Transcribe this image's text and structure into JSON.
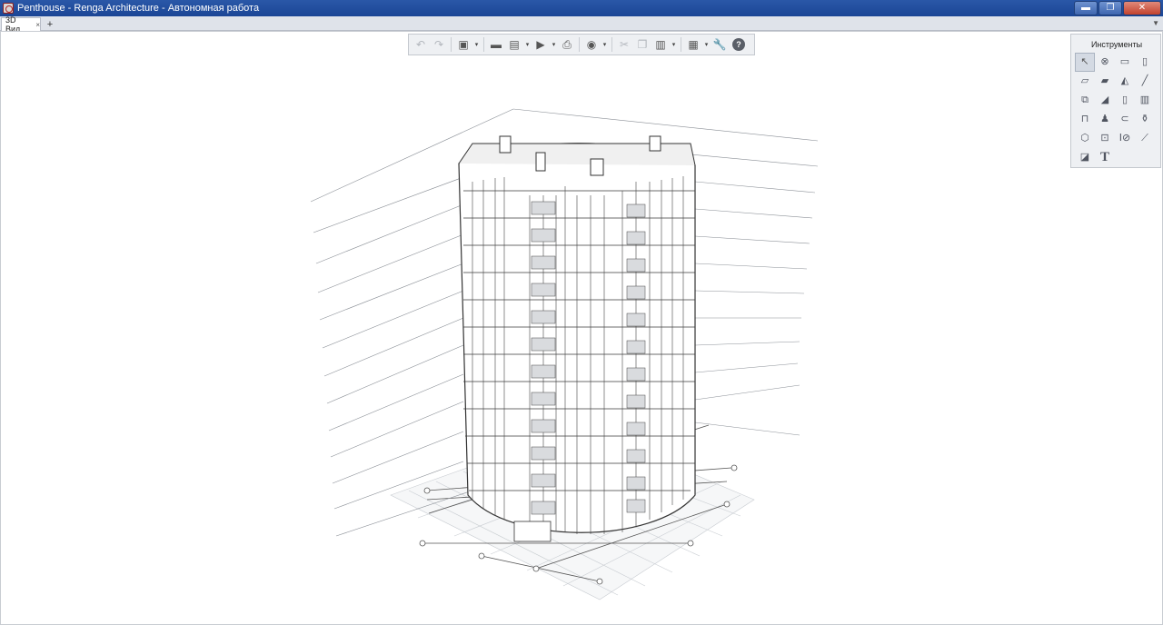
{
  "window": {
    "title": "Penthouse - Renga Architecture - Автономная работа"
  },
  "window_controls": {
    "minimize": "▬",
    "maximize": "❐",
    "close": "✕"
  },
  "tabs": {
    "active_label": "3D Вид",
    "close_glyph": "×",
    "add_glyph": "+",
    "menu_glyph": "▼"
  },
  "toolbar": {
    "undo": "↶",
    "redo": "↷",
    "view_cube": "▣",
    "open": "▬",
    "save": "▤",
    "export": "▶",
    "print": "⎙",
    "orbit": "◉",
    "cut": "✂",
    "copy": "❐",
    "paste": "▥",
    "display": "▦",
    "settings": "🔧",
    "help": "?",
    "arrow": "▾"
  },
  "tools_panel": {
    "title": "Инструменты",
    "items": [
      {
        "name": "select",
        "glyph": "↖"
      },
      {
        "name": "axis",
        "glyph": "⊗"
      },
      {
        "name": "room",
        "glyph": "▭"
      },
      {
        "name": "column",
        "glyph": "▯"
      },
      {
        "name": "wall",
        "glyph": "▱"
      },
      {
        "name": "floor",
        "glyph": "▰"
      },
      {
        "name": "roof",
        "glyph": "◭"
      },
      {
        "name": "beam",
        "glyph": "╱"
      },
      {
        "name": "stair",
        "glyph": "⧉"
      },
      {
        "name": "ramp",
        "glyph": "◢"
      },
      {
        "name": "door",
        "glyph": "▯"
      },
      {
        "name": "window",
        "glyph": "▥"
      },
      {
        "name": "railing",
        "glyph": "⊓"
      },
      {
        "name": "equipment",
        "glyph": "♟"
      },
      {
        "name": "pipe",
        "glyph": "⊂"
      },
      {
        "name": "plumbing",
        "glyph": "⚱"
      },
      {
        "name": "element",
        "glyph": "⬡"
      },
      {
        "name": "opening",
        "glyph": "⊡"
      },
      {
        "name": "dimension",
        "glyph": "Ⅰ⊘"
      },
      {
        "name": "level",
        "glyph": "⟋"
      },
      {
        "name": "hatch",
        "glyph": "◪"
      },
      {
        "name": "text",
        "glyph": "T"
      }
    ]
  }
}
